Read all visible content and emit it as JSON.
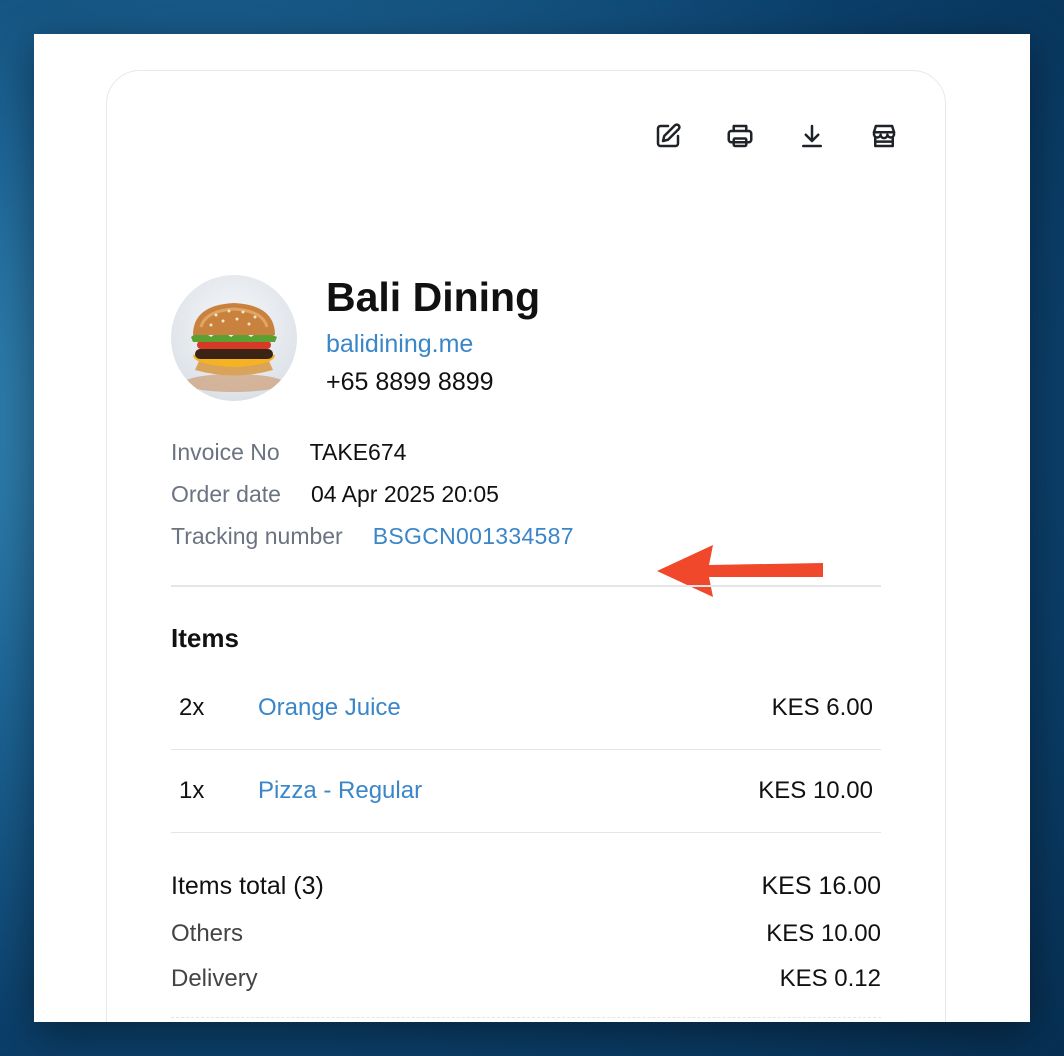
{
  "toolbar": {
    "edit_icon": "edit-icon",
    "print_icon": "printer-icon",
    "download_icon": "download-icon",
    "store_icon": "store-icon"
  },
  "store": {
    "name": "Bali Dining",
    "website": "balidining.me",
    "phone": "+65 8899 8899"
  },
  "invoice": {
    "invoice_no_label": "Invoice No",
    "invoice_no": "TAKE674",
    "order_date_label": "Order date",
    "order_date": "04 Apr 2025 20:05",
    "tracking_label": "Tracking number",
    "tracking_number": "BSGCN001334587"
  },
  "items_section": {
    "title": "Items",
    "rows": [
      {
        "qty": "2x",
        "name": "Orange Juice",
        "price": "KES 6.00"
      },
      {
        "qty": "1x",
        "name": "Pizza - Regular",
        "price": "KES 10.00"
      }
    ]
  },
  "totals": {
    "items_total_label": "Items total (3)",
    "items_total": "KES 16.00",
    "others_label": "Others",
    "others": "KES 10.00",
    "delivery_label": "Delivery",
    "delivery": "KES 0.12"
  },
  "colors": {
    "link": "#3a86c8",
    "annotation_arrow": "#f0482a"
  }
}
